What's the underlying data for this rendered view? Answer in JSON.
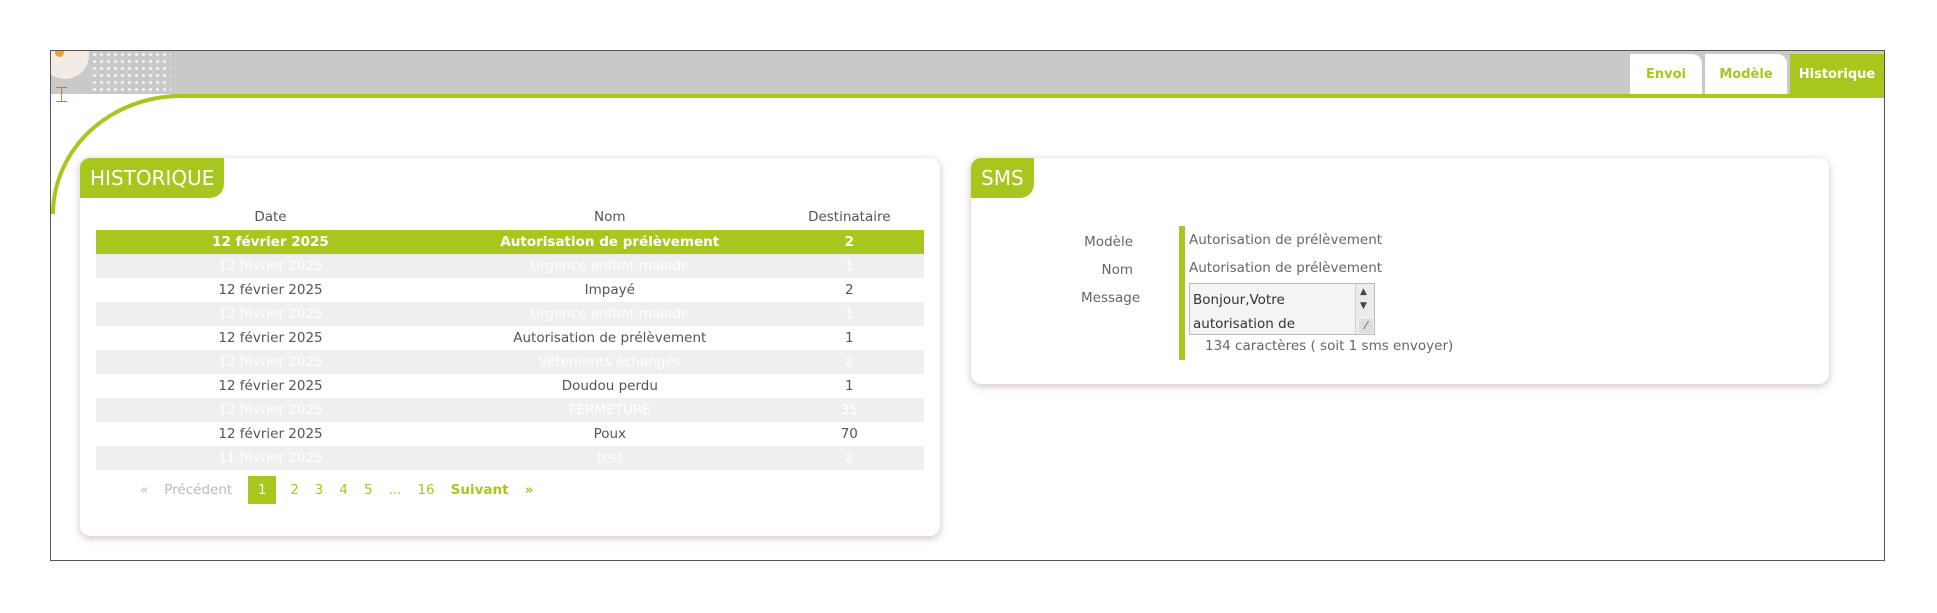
{
  "tabs": [
    {
      "label": "Envoi",
      "active": false
    },
    {
      "label": "Modèle",
      "active": false
    },
    {
      "label": "Historique",
      "active": true
    }
  ],
  "history": {
    "title": "HISTORIQUE",
    "columns": [
      "Date",
      "Nom",
      "Destinataire"
    ],
    "rows": [
      {
        "date": "12 février 2025",
        "nom": "Autorisation de prélèvement",
        "dest": "2"
      },
      {
        "date": "12 février 2025",
        "nom": "Urgence enfant malade",
        "dest": "1"
      },
      {
        "date": "12 février 2025",
        "nom": "Impayé",
        "dest": "2"
      },
      {
        "date": "12 février 2025",
        "nom": "Urgence enfant malade",
        "dest": "1"
      },
      {
        "date": "12 février 2025",
        "nom": "Autorisation de prélèvement",
        "dest": "1"
      },
      {
        "date": "12 février 2025",
        "nom": "Vêtements échangés",
        "dest": "2"
      },
      {
        "date": "12 février 2025",
        "nom": "Doudou perdu",
        "dest": "1"
      },
      {
        "date": "12 février 2025",
        "nom": "FERMETURE",
        "dest": "35"
      },
      {
        "date": "12 février 2025",
        "nom": "Poux",
        "dest": "70"
      },
      {
        "date": "11 février 2025",
        "nom": "test",
        "dest": "2"
      }
    ],
    "pagination": {
      "first": "«",
      "prev": "Précédent",
      "pages": [
        "1",
        "2",
        "3",
        "4",
        "5",
        "...",
        "16"
      ],
      "next": "Suivant",
      "last": "»"
    }
  },
  "sms": {
    "title": "SMS",
    "labels": {
      "model": "Modèle",
      "name": "Nom",
      "message": "Message"
    },
    "model": "Autorisation de prélèvement",
    "name": "Autorisation de prélèvement",
    "message": "Bonjour,Votre autorisation de",
    "char_count": "134 caractères ( soit 1 sms envoyer)"
  },
  "colors": {
    "accent": "#a8c71e",
    "band": "#c9c9c9"
  }
}
